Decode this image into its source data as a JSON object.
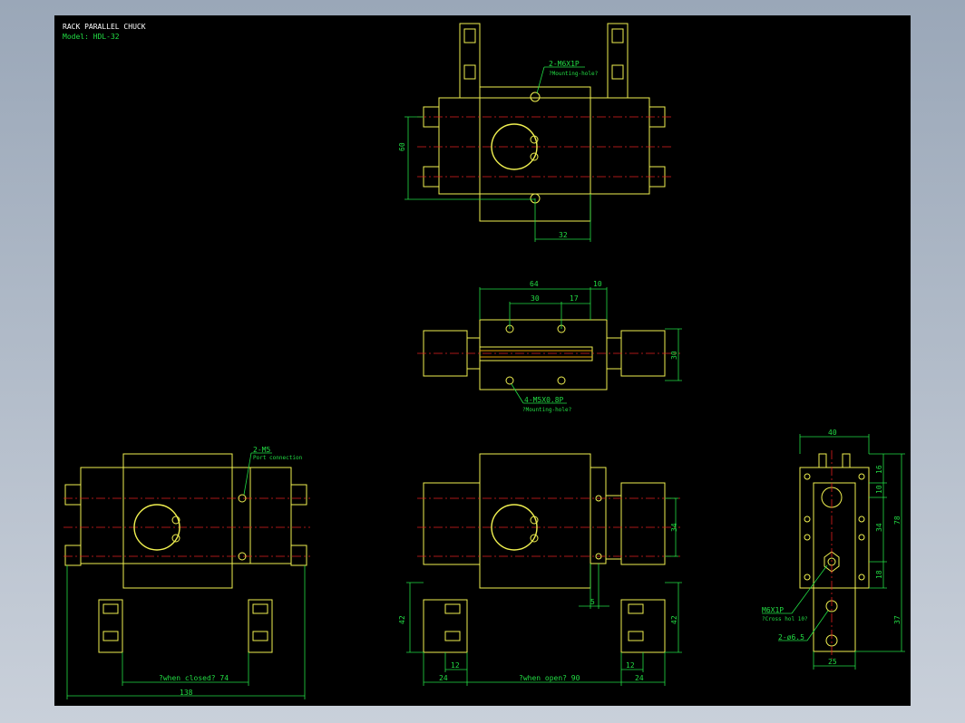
{
  "title": {
    "line1": "RACK PARALLEL CHUCK",
    "line2": "Model: HDL-32"
  },
  "colors": {
    "background": "#000000",
    "outline": "#f0f050",
    "dimension": "#22dd44",
    "centerline": "#e02020",
    "frame": "#9aa7b8"
  },
  "top_view": {
    "note1": "2-M6X1P",
    "note2": "?Mounting-hole?",
    "dim_left": "60",
    "dim_bottom": "32"
  },
  "middle_view": {
    "dim_64": "64",
    "dim_10": "10",
    "dim_30": "30",
    "dim_17": "17",
    "dim_right": "30",
    "note1": "4-M5X0.8P",
    "note2": "?Mounting-hole?"
  },
  "left_view": {
    "note1": "2-M5",
    "note2": "Port connection",
    "dim_closed": "?when closed? 74",
    "dim_total": "138"
  },
  "center_view": {
    "dim_34": "34",
    "dim_5": "5",
    "dim_42_left": "42",
    "dim_42_right": "42",
    "dim_12_left": "12",
    "dim_12_right": "12",
    "dim_24_left": "24",
    "dim_24_right": "24",
    "dim_open": "?when open? 90"
  },
  "side_view": {
    "dim_40": "40",
    "dim_16": "16",
    "dim_10": "10",
    "dim_34": "34",
    "dim_78": "78",
    "dim_18": "18",
    "dim_37": "37",
    "dim_25": "25",
    "note1": "M6X1P",
    "note2": "?Cross hol 10?",
    "note3": "2-ø6.5"
  }
}
